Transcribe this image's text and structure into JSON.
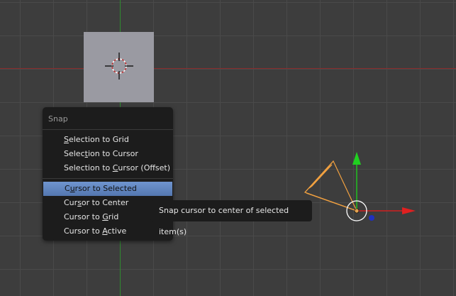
{
  "menu": {
    "title": "Snap",
    "items": [
      {
        "pre": "",
        "key": "S",
        "post": "election to Grid"
      },
      {
        "pre": "Selec",
        "key": "t",
        "post": "ion to Cursor"
      },
      {
        "pre": "Selection to ",
        "key": "C",
        "post": "ursor (Offset)"
      },
      {
        "pre": "C",
        "key": "u",
        "post": "rsor to Selected"
      },
      {
        "pre": "Cur",
        "key": "s",
        "post": "or to Center"
      },
      {
        "pre": "Cursor to ",
        "key": "G",
        "post": "rid"
      },
      {
        "pre": "Cursor to ",
        "key": "A",
        "post": "ctive"
      }
    ]
  },
  "tooltip": "Snap cursor to center of selected item(s)",
  "colors": {
    "background": "#3d3d3d",
    "highlight": "#5f86c0",
    "selected_object": "#f0a040"
  }
}
